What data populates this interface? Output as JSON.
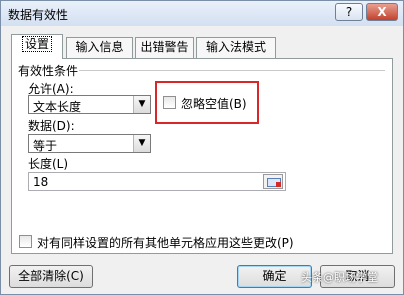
{
  "window": {
    "title": "数据有效性",
    "help_label": "?",
    "close_label": "X"
  },
  "tabs": [
    {
      "label": "设置"
    },
    {
      "label": "输入信息"
    },
    {
      "label": "出错警告"
    },
    {
      "label": "输入法模式"
    }
  ],
  "settings": {
    "group_title": "有效性条件",
    "allow_label": "允许(A):",
    "allow_value": "文本长度",
    "ignore_blank_label": "忽略空值(B)",
    "ignore_blank_checked": false,
    "data_label": "数据(D):",
    "data_value": "等于",
    "length_label": "长度(L)",
    "length_value": "18",
    "apply_all_label": "对有同样设置的所有其他单元格应用这些更改(P)",
    "apply_all_checked": false
  },
  "footer": {
    "clear_all_label": "全部清除(C)",
    "ok_label": "确定",
    "cancel_label": "取消"
  },
  "watermark": "头条@职场学堂",
  "colors": {
    "highlight_border": "#d8262a",
    "title_gradient_top": "#e9f0fa",
    "close_button": "#c2412c"
  }
}
